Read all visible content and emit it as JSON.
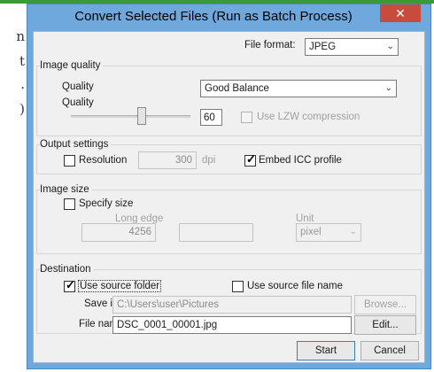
{
  "background_window": {
    "chars": [
      "n",
      "t",
      ".",
      ")"
    ]
  },
  "dialog": {
    "title": "Convert Selected Files (Run as Batch Process)",
    "close_label": "✕"
  },
  "file_format": {
    "label": "File format:",
    "value": "JPEG"
  },
  "image_quality": {
    "group_title": "Image quality",
    "quality_label": "Quality",
    "quality_preset": "Good Balance",
    "quality_slider_label": "Quality",
    "quality_value": "60",
    "quality_fraction": 0.6,
    "lzw_label": "Use LZW compression",
    "lzw_checked": false
  },
  "output_settings": {
    "group_title": "Output settings",
    "resolution_label": "Resolution",
    "resolution_checked": false,
    "resolution_value": "300",
    "resolution_unit": "dpi",
    "embed_icc_label": "Embed ICC profile",
    "embed_icc_checked": true
  },
  "image_size": {
    "group_title": "Image size",
    "specify_size_label": "Specify size",
    "specify_size_checked": false,
    "long_edge_label": "Long edge",
    "long_edge_value": "4256",
    "second_value": "",
    "unit_label": "Unit",
    "unit_value": "pixel"
  },
  "destination": {
    "group_title": "Destination",
    "use_source_folder_label": "Use source folder",
    "use_source_folder_checked": true,
    "use_source_file_name_label": "Use source file name",
    "use_source_file_name_checked": false,
    "save_in_label": "Save in:",
    "save_in_value": "C:\\Users\\user\\Pictures",
    "browse_label": "Browse...",
    "file_name_label": "File name:",
    "file_name_value": "DSC_0001_00001.jpg",
    "edit_label": "Edit..."
  },
  "buttons": {
    "start_label": "Start",
    "cancel_label": "Cancel"
  },
  "icons": {
    "dropdown": "chevron-down-icon",
    "check": "checkmark-icon",
    "close": "close-icon"
  },
  "colors": {
    "title_bar": "#6fa8dc",
    "close_button": "#c74c3c",
    "green_bar": "#3a9a3a"
  }
}
